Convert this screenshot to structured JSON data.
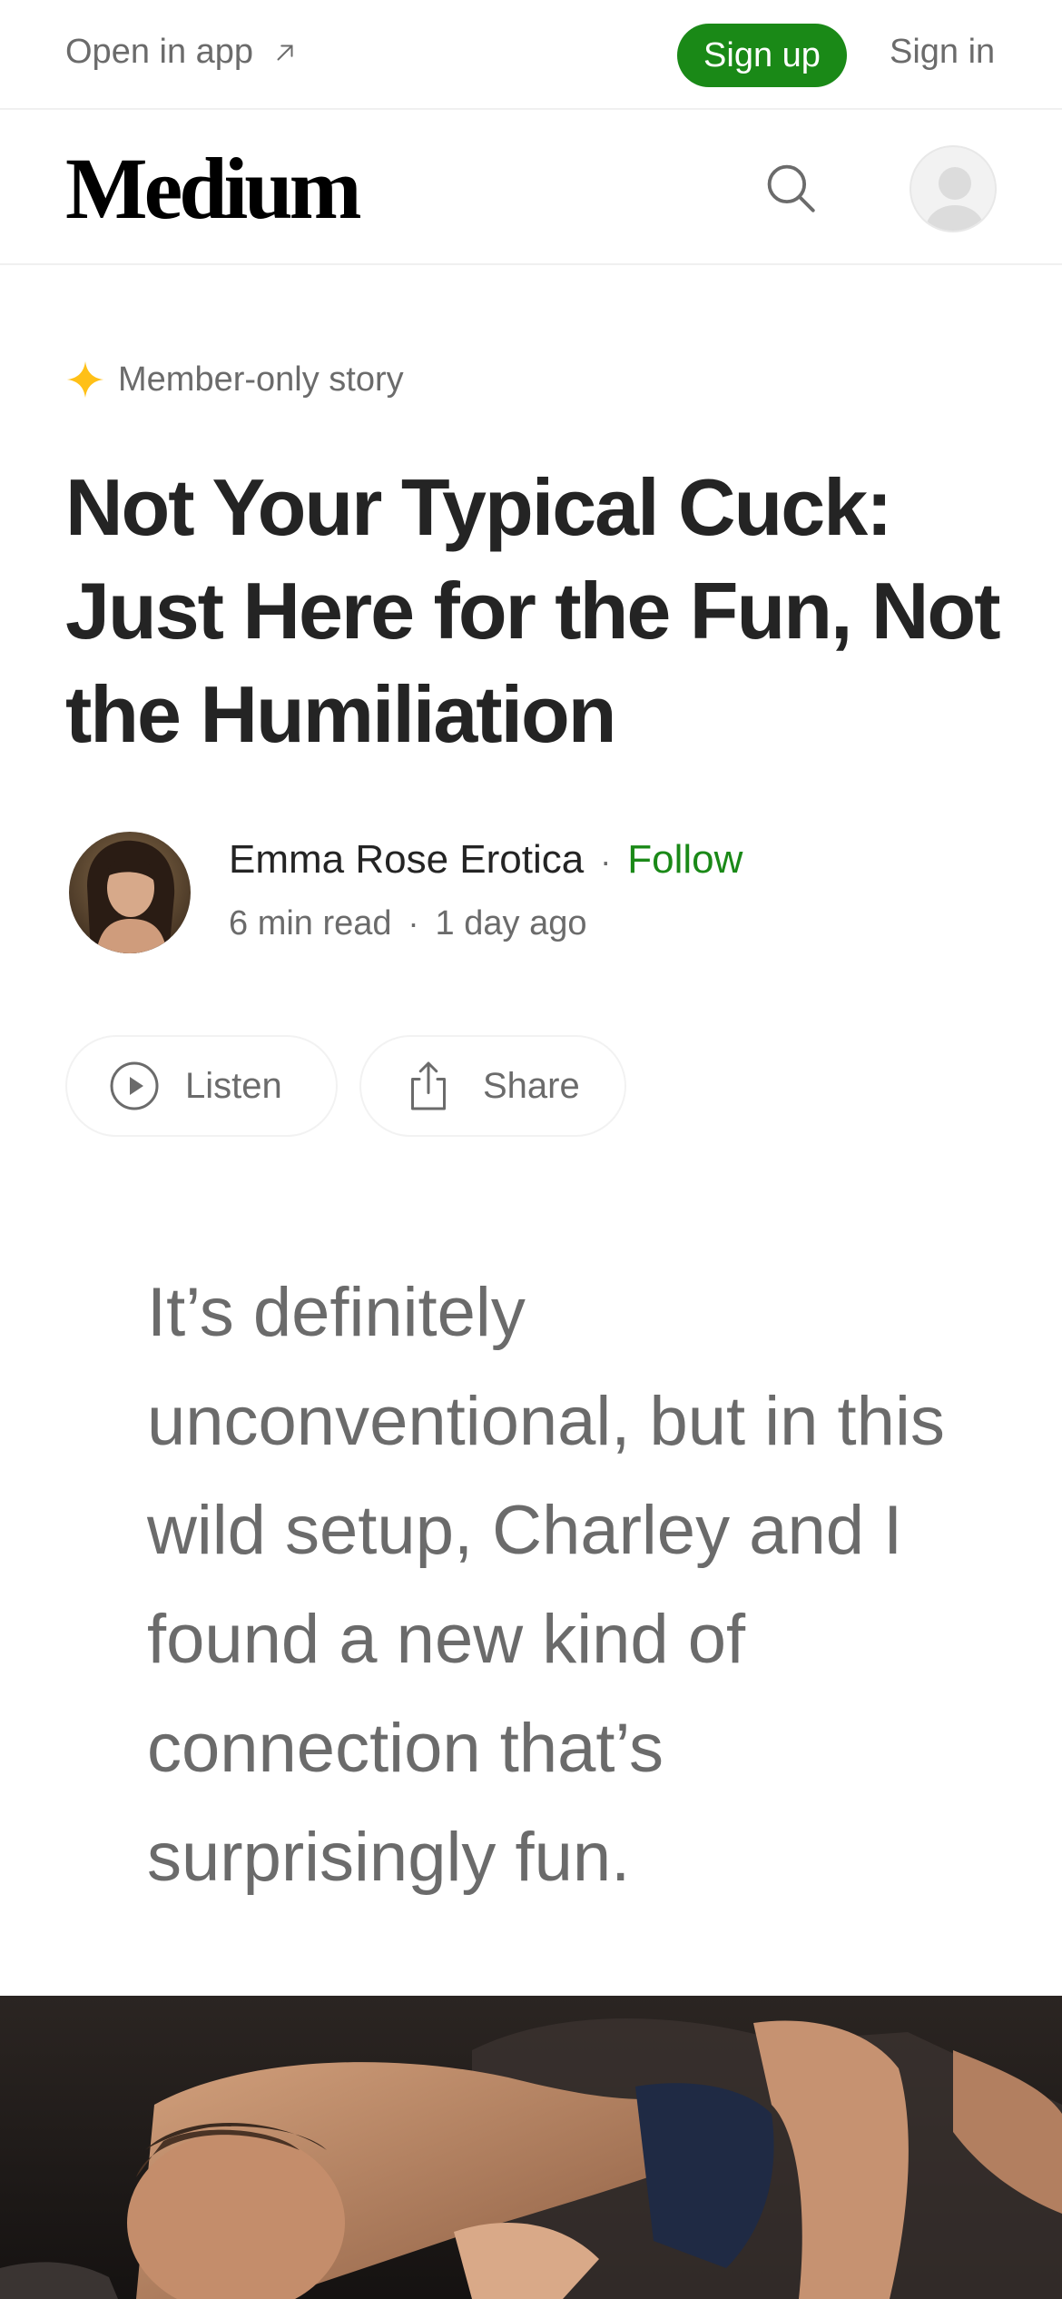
{
  "topbar": {
    "open_in_app": "Open in app",
    "sign_up": "Sign up",
    "sign_in": "Sign in"
  },
  "header": {
    "logo": "Medium"
  },
  "article": {
    "badge": "Member-only story",
    "title": "Not Your Typical Cuck: Just Here for the Fun, Not the Humiliation",
    "author": "Emma Rose Erotica",
    "follow": "Follow",
    "read_time": "6 min read",
    "published": "1 day ago",
    "listen": "Listen",
    "share": "Share",
    "subtitle": "It’s definitely unconventional, but in this wild setup, Charley and I found a new kind of connection that’s surprisingly fun."
  },
  "colors": {
    "accent_green": "#1a8917",
    "member_star": "#ffc017",
    "text_primary": "#242424",
    "text_secondary": "#6b6b6b"
  },
  "icons": [
    "arrow-up-right-icon",
    "search-icon",
    "user-avatar-icon",
    "star-icon",
    "play-circle-icon",
    "share-icon"
  ]
}
